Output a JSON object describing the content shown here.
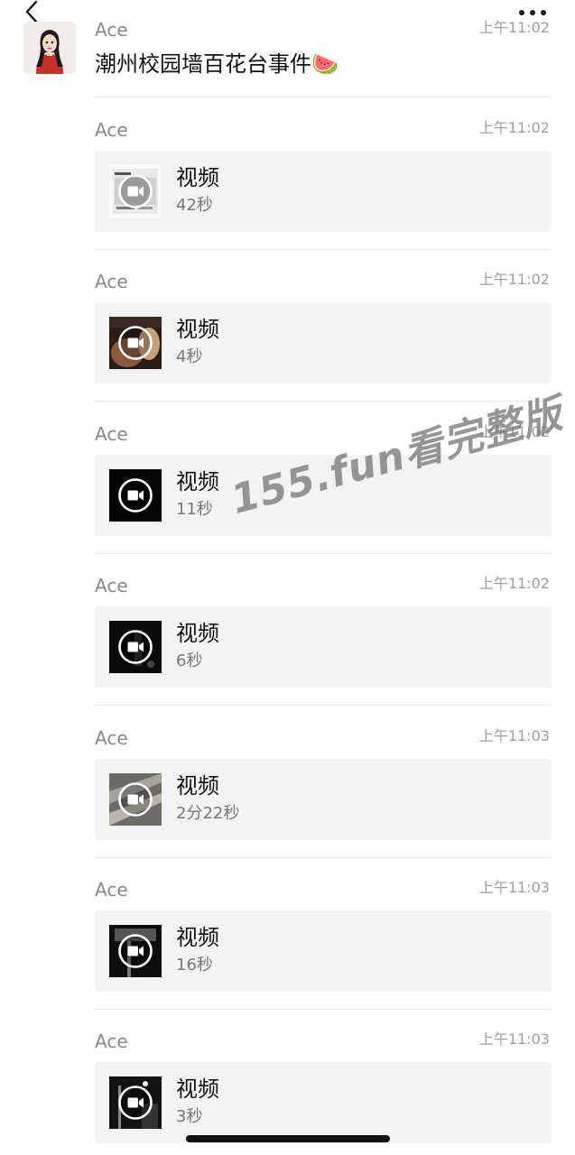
{
  "header": {
    "back_icon": "chevron-left-icon",
    "more_icon": "more-dots-icon"
  },
  "first_message": {
    "sender": "Ace",
    "time": "上午11:02",
    "text": "潮州校园墙百花台事件🍉"
  },
  "video_messages": [
    {
      "sender": "Ace",
      "time": "上午11:02",
      "title": "视频",
      "duration": "42秒",
      "thumb": "light"
    },
    {
      "sender": "Ace",
      "time": "上午11:02",
      "title": "视频",
      "duration": "4秒",
      "thumb": "warm"
    },
    {
      "sender": "Ace",
      "time": "上午11:02",
      "title": "视频",
      "duration": "11秒",
      "thumb": "black"
    },
    {
      "sender": "Ace",
      "time": "上午11:02",
      "title": "视频",
      "duration": "6秒",
      "thumb": "dark"
    },
    {
      "sender": "Ace",
      "time": "上午11:03",
      "title": "视频",
      "duration": "2分22秒",
      "thumb": "grey"
    },
    {
      "sender": "Ace",
      "time": "上午11:03",
      "title": "视频",
      "duration": "16秒",
      "thumb": "night"
    },
    {
      "sender": "Ace",
      "time": "上午11:03",
      "title": "视频",
      "duration": "3秒",
      "thumb": "night2"
    }
  ],
  "watermark": "155.fun看完整版",
  "colors": {
    "background": "#ffffff",
    "card": "#f3f3f3",
    "sender": "#888888",
    "time": "#9e9e9e"
  }
}
